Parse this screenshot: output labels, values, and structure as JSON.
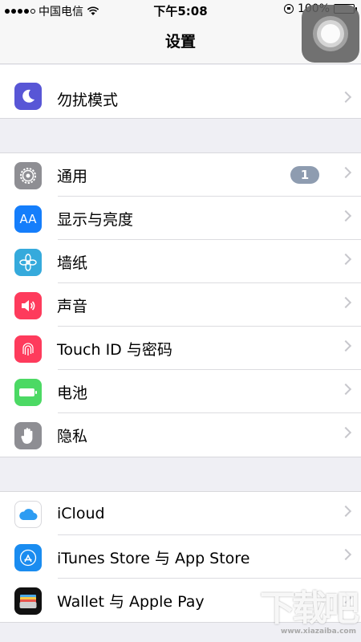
{
  "status_bar": {
    "carrier": "中国电信",
    "time": "下午5:08",
    "battery": "100%",
    "battery_level": 1.0,
    "signal_bars": 4
  },
  "nav": {
    "title": "设置"
  },
  "groups": [
    {
      "items": [
        {
          "label": "勿扰模式",
          "icon": "moon-icon",
          "color": "#5856d6"
        }
      ]
    },
    {
      "items": [
        {
          "label": "通用",
          "icon": "gear-icon",
          "color": "#8e8e93",
          "badge": "1"
        },
        {
          "label": "显示与亮度",
          "icon": "text-size-icon",
          "color": "#157efb",
          "icon_text": "AA"
        },
        {
          "label": "墙纸",
          "icon": "flower-icon",
          "color": "#35aadc"
        },
        {
          "label": "声音",
          "icon": "speaker-icon",
          "color": "#fe3b5c"
        },
        {
          "label": "Touch ID 与密码",
          "icon": "fingerprint-icon",
          "color": "#fe3b5c"
        },
        {
          "label": "电池",
          "icon": "battery-icon",
          "color": "#4cd964"
        },
        {
          "label": "隐私",
          "icon": "hand-icon",
          "color": "#8e8e93"
        }
      ]
    },
    {
      "items": [
        {
          "label": "iCloud",
          "icon": "cloud-icon",
          "color": "#ffffff"
        },
        {
          "label": "iTunes Store 与 App Store",
          "icon": "app-store-icon",
          "color": "#1a8cf0"
        },
        {
          "label": "Wallet 与 Apple Pay",
          "icon": "wallet-icon",
          "color": "#111111"
        }
      ]
    }
  ],
  "watermark": {
    "text": "下载吧",
    "subtext": "www.xiazaiba.com"
  }
}
